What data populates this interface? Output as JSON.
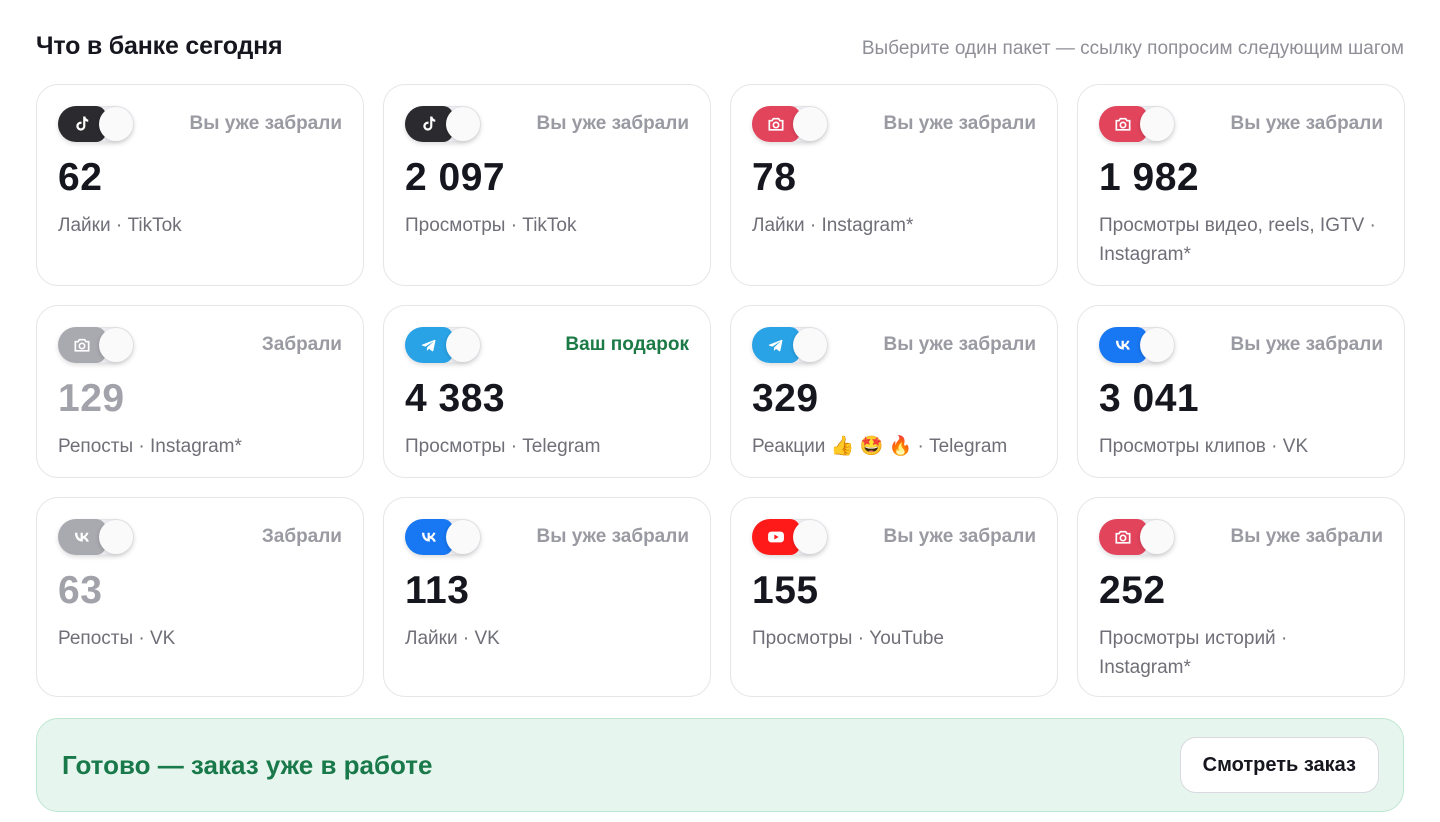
{
  "header": {
    "title": "Что в банке сегодня",
    "hint": "Выберите один пакет — ссылку попросим следующим шагом"
  },
  "colors": {
    "tiktok": "#2b2b2f",
    "instagram": "#e2445c",
    "telegram": "#2aa3e6",
    "vk": "#1877f2",
    "youtube": "#ff1a1a",
    "disabled": "#a9a9b0",
    "gift_text": "#1b7a46",
    "banner_bg": "#e6f6ee"
  },
  "cards": [
    {
      "icon": "tiktok-icon",
      "platform": "tiktok",
      "status": "Вы уже забрали",
      "count": "62",
      "desc": "Лайки · TikTok",
      "muted": false,
      "gift": false
    },
    {
      "icon": "tiktok-icon",
      "platform": "tiktok",
      "status": "Вы уже забрали",
      "count": "2 097",
      "desc": "Просмотры · TikTok",
      "muted": false,
      "gift": false
    },
    {
      "icon": "instagram-camera-icon",
      "platform": "instagram",
      "status": "Вы уже забрали",
      "count": "78",
      "desc": "Лайки · Instagram*",
      "muted": false,
      "gift": false
    },
    {
      "icon": "instagram-camera-icon",
      "platform": "instagram",
      "status": "Вы уже забрали",
      "count": "1 982",
      "desc": "Просмотры видео, reels, IGTV · Instagram*",
      "muted": false,
      "gift": false
    },
    {
      "icon": "instagram-camera-icon",
      "platform": "disabled",
      "status": "Забрали",
      "count": "129",
      "desc": "Репосты · Instagram*",
      "muted": true,
      "gift": false
    },
    {
      "icon": "telegram-icon",
      "platform": "telegram",
      "status": "Ваш подарок",
      "count": "4 383",
      "desc": "Просмотры · Telegram",
      "muted": false,
      "gift": true
    },
    {
      "icon": "telegram-icon",
      "platform": "telegram",
      "status": "Вы уже забрали",
      "count": "329",
      "desc": "Реакции 👍 🤩 🔥  · Telegram",
      "muted": false,
      "gift": false
    },
    {
      "icon": "vk-icon",
      "platform": "vk",
      "status": "Вы уже забрали",
      "count": "3 041",
      "desc": "Просмотры клипов · VK",
      "muted": false,
      "gift": false
    },
    {
      "icon": "vk-icon",
      "platform": "disabled",
      "status": "Забрали",
      "count": "63",
      "desc": "Репосты · VK",
      "muted": true,
      "gift": false
    },
    {
      "icon": "vk-icon",
      "platform": "vk",
      "status": "Вы уже забрали",
      "count": "113",
      "desc": "Лайки · VK",
      "muted": false,
      "gift": false
    },
    {
      "icon": "youtube-icon",
      "platform": "youtube",
      "status": "Вы уже забрали",
      "count": "155",
      "desc": "Просмотры · YouTube",
      "muted": false,
      "gift": false
    },
    {
      "icon": "instagram-camera-icon",
      "platform": "instagram",
      "status": "Вы уже забрали",
      "count": "252",
      "desc": "Просмотры историй · Instagram*",
      "muted": false,
      "gift": false
    }
  ],
  "banner": {
    "message": "Готово — заказ уже в работе",
    "button_label": "Смотреть заказ"
  }
}
